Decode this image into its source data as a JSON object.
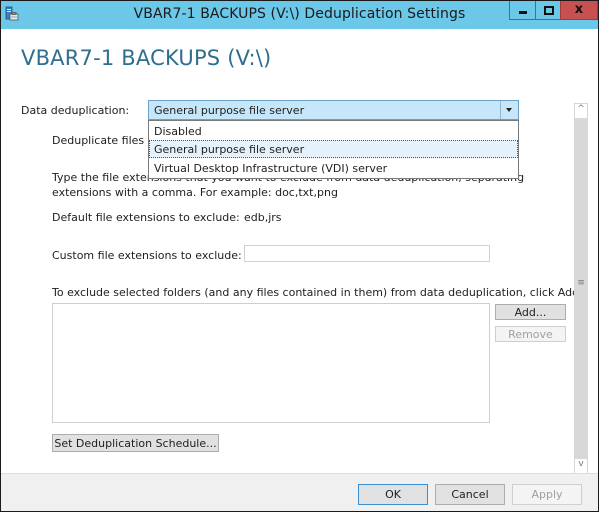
{
  "window": {
    "title": "VBAR7-1 BACKUPS (V:\\) Deduplication Settings",
    "close_glyph": "x"
  },
  "heading": "VBAR7-1 BACKUPS (V:\\)",
  "dedup": {
    "label": "Data deduplication:",
    "selected": "General purpose file server",
    "options": [
      "Disabled",
      "General purpose file server",
      "Virtual Desktop Infrastructure (VDI) server"
    ],
    "highlighted_index": 1
  },
  "dedup_files_older_label": "Deduplicate files ol",
  "instructions_line1": "Type the file extensions that you want to exclude from data deduplication, separating",
  "instructions_line2": "extensions with a comma. For example: doc,txt,png",
  "default_ext": {
    "label": "Default file extensions to exclude:",
    "value": "edb,jrs"
  },
  "custom_ext": {
    "label": "Custom file extensions to exclude:",
    "value": ""
  },
  "folders": {
    "label": "To exclude selected folders (and any files contained in them) from data deduplication, click Add.",
    "items": [],
    "add_label": "Add...",
    "remove_label": "Remove"
  },
  "schedule_button": "Set Deduplication Schedule...",
  "footer": {
    "ok": "OK",
    "cancel": "Cancel",
    "apply": "Apply"
  },
  "scrollbar": {
    "up_glyph": "^",
    "down_glyph": "v",
    "grip_glyph": "≡"
  }
}
